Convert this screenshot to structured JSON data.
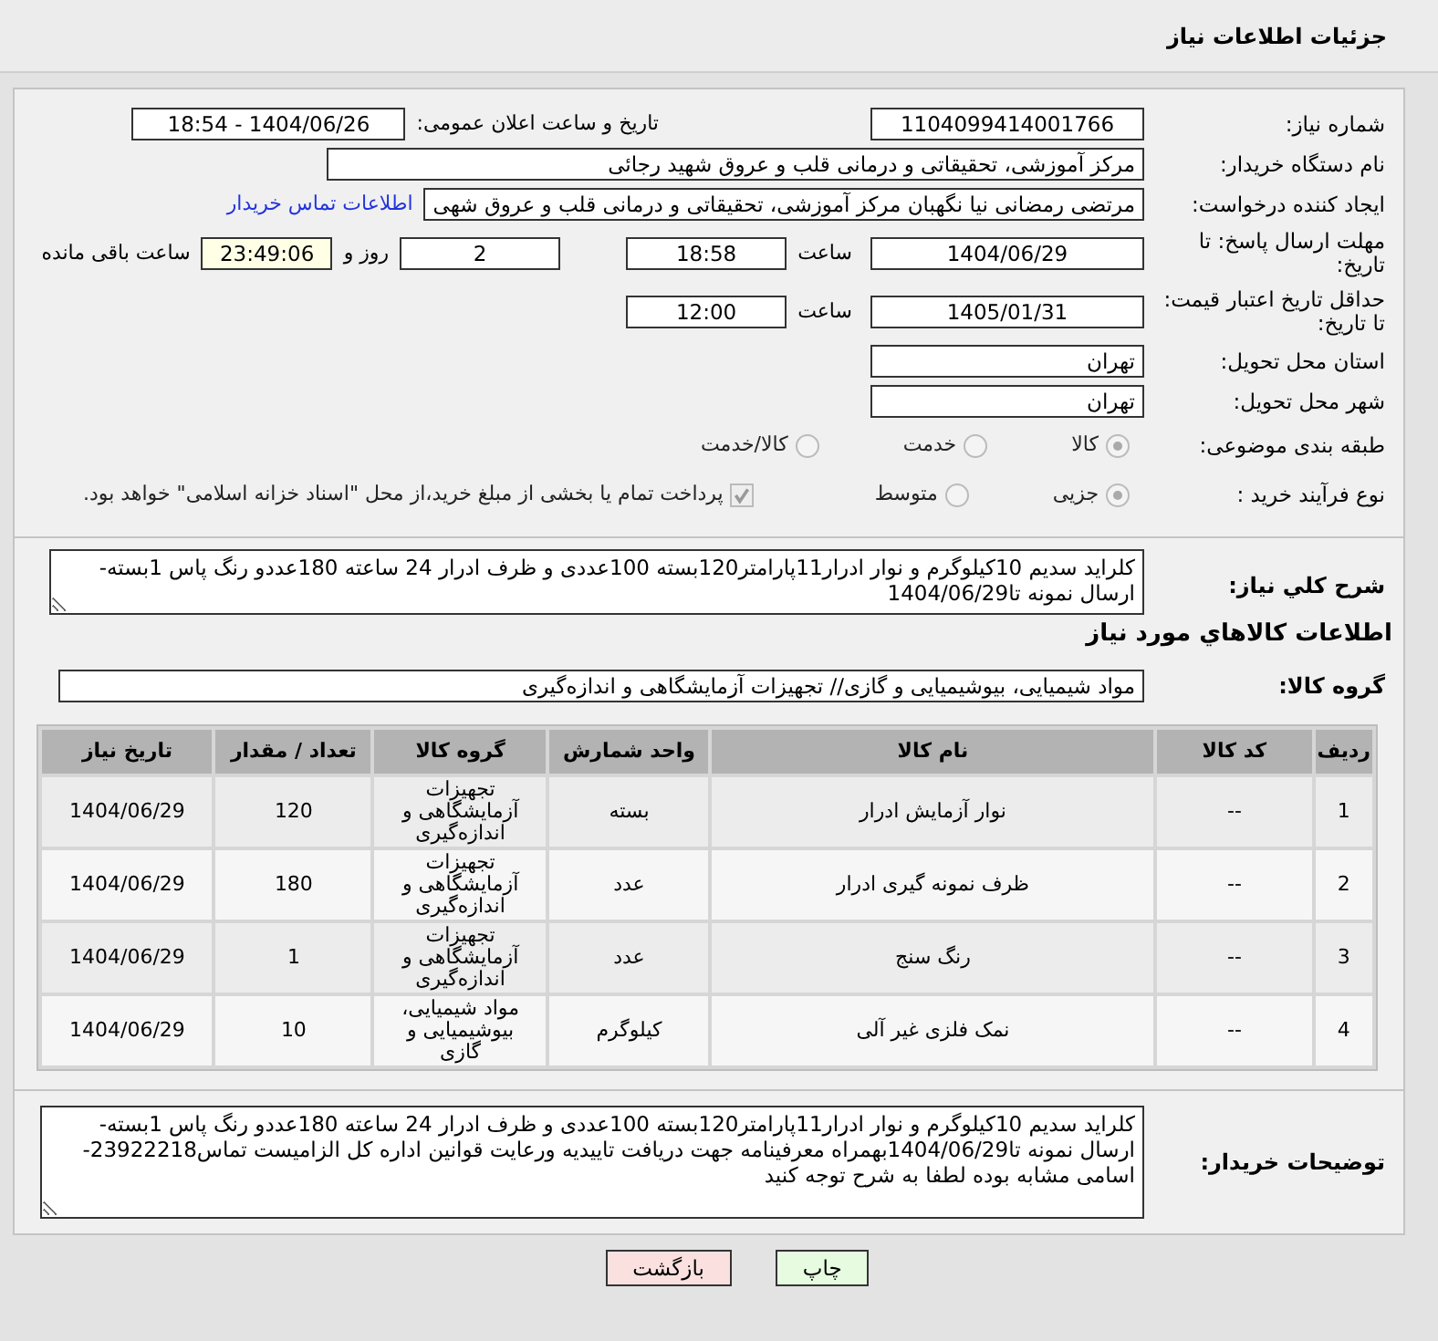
{
  "header": {
    "title": "جزئیات اطلاعات نیاز"
  },
  "need_number": {
    "label": "شماره نیاز:",
    "value": "1104099414001766"
  },
  "announce": {
    "label": "تاریخ و ساعت اعلان عمومی:",
    "value": "1404/06/26 - 18:54"
  },
  "buyer": {
    "label": "نام دستگاه خریدار:",
    "value": "مرکز آموزشی، تحقیقاتی و درمانی قلب و عروق شهید رجائی"
  },
  "creator": {
    "label": "ایجاد کننده درخواست:",
    "value": "مرتضی رمضانی نیا نگهبان مرکز آموزشی، تحقیقاتی و درمانی قلب و عروق شهی",
    "link": "اطلاعات تماس خریدار"
  },
  "deadline": {
    "label": "مهلت ارسال پاسخ: تا تاریخ:",
    "date": "1404/06/29",
    "time_label": "ساعت",
    "time": "18:58",
    "days": "2",
    "days_label": "روز و",
    "remaining": "23:49:06",
    "remaining_label": "ساعت باقی مانده"
  },
  "validity": {
    "label": "حداقل تاریخ اعتبار قیمت: تا تاریخ:",
    "date": "1405/01/31",
    "time_label": "ساعت",
    "time": "12:00"
  },
  "province": {
    "label": "استان محل تحویل:",
    "value": "تهران"
  },
  "city": {
    "label": "شهر محل تحویل:",
    "value": "تهران"
  },
  "category": {
    "label": "طبقه بندی موضوعی:",
    "options": [
      {
        "label": "کالا",
        "selected": true
      },
      {
        "label": "خدمت",
        "selected": false
      },
      {
        "label": "کالا/خدمت",
        "selected": false
      }
    ]
  },
  "process": {
    "label": "نوع فرآیند خرید :",
    "options": [
      {
        "label": "جزیی",
        "selected": true
      },
      {
        "label": "متوسط",
        "selected": false
      }
    ],
    "treasury": {
      "label": "پرداخت تمام یا بخشی از مبلغ خرید،از محل \"اسناد خزانه اسلامی\" خواهد بود.",
      "checked": true
    }
  },
  "description": {
    "label": "شرح کلي نياز:",
    "value": "کلراید سدیم 10کیلوگرم و نوار ادرار11پارامتر120بسته 100عددی و ظرف ادرار 24 ساعته 180عددو رنگ پاس 1بسته-ارسال نمونه تا1404/06/29"
  },
  "goods_title": "اطلاعات کالاهاي مورد نياز",
  "group": {
    "label": "گروه کالا:",
    "value": "مواد شیمیایی، بیوشیمیایی و  گازی// تجهیزات آزمایشگاهی و اندازه‌گیری"
  },
  "table": {
    "columns": [
      "ردیف",
      "کد کالا",
      "نام کالا",
      "واحد شمارش",
      "گروه کالا",
      "تعداد / مقدار",
      "تاریخ نیاز"
    ],
    "rows": [
      [
        "1",
        "--",
        "نوار آزمایش ادرار",
        "بسته",
        "تجهیزات آزمایشگاهی و اندازه‌گیری",
        "120",
        "1404/06/29"
      ],
      [
        "2",
        "--",
        "ظرف نمونه گیری ادرار",
        "عدد",
        "تجهیزات آزمایشگاهی و اندازه‌گیری",
        "180",
        "1404/06/29"
      ],
      [
        "3",
        "--",
        "رنگ سنج",
        "عدد",
        "تجهیزات آزمایشگاهی و اندازه‌گیری",
        "1",
        "1404/06/29"
      ],
      [
        "4",
        "--",
        "نمک فلزی غیر آلی",
        "کیلوگرم",
        "مواد شیمیایی، بیوشیمیایی و گازی",
        "10",
        "1404/06/29"
      ]
    ]
  },
  "notes": {
    "label": "توضیحات خریدار:",
    "value": "کلراید سدیم 10کیلوگرم و نوار ادرار11پارامتر120بسته 100عددی و ظرف ادرار 24 ساعته 180عددو رنگ پاس 1بسته-ارسال نمونه تا1404/06/29بهمراه معرفینامه جهت دریافت تاییدیه ورعایت قوانین اداره کل الزامیست تماس23922218-اسامی مشابه بوده لطفا به شرح توجه کنید"
  },
  "buttons": [
    {
      "label": "چاپ",
      "color": "#e6fbe0"
    },
    {
      "label": "بازگشت",
      "color": "#fbe0e0"
    }
  ]
}
